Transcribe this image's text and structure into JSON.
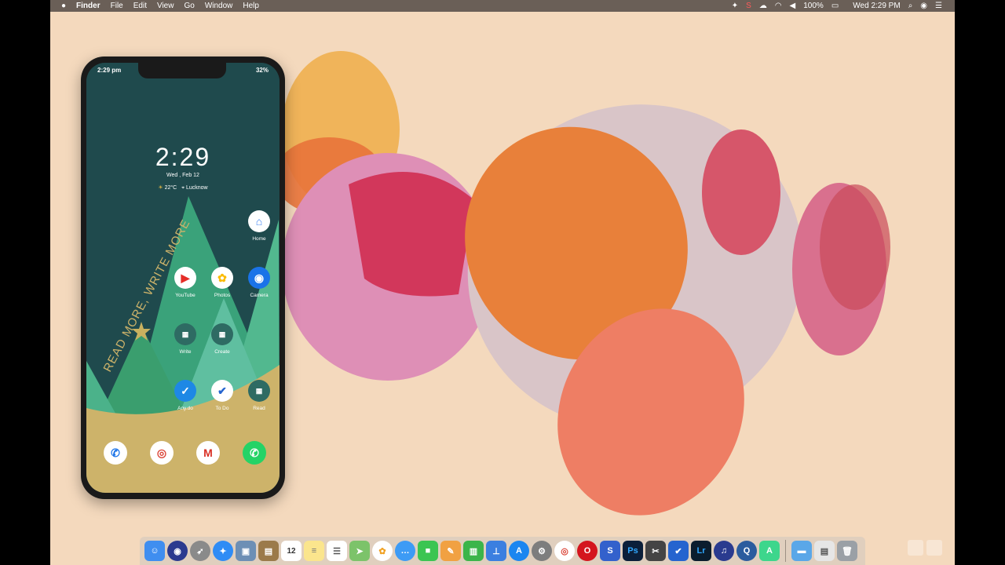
{
  "menubar": {
    "apple": "",
    "app": "Finder",
    "items": [
      "File",
      "Edit",
      "View",
      "Go",
      "Window",
      "Help"
    ],
    "battery": "100%",
    "datetime": "Wed 2:29 PM"
  },
  "phone": {
    "status_time": "2:29 pm",
    "status_battery": "32%",
    "clock": "2:29",
    "date": "Wed , Feb 12",
    "temperature": "22°C",
    "location": "Lucknow",
    "wallpaper_text": "READ MORE, WRITE MORE",
    "apps": {
      "home": "Home",
      "youtube": "YouTube",
      "photos": "Photos",
      "camera": "Camera",
      "write": "Write",
      "create": "Create",
      "anydo": "Any.do",
      "todo": "To Do",
      "read": "Read"
    }
  },
  "dock": {
    "icons": [
      "finder-icon",
      "siri-icon",
      "launchpad-icon",
      "safari-icon",
      "preview-icon",
      "notes-book-icon",
      "calendar-icon",
      "notes-icon",
      "reminders-icon",
      "maps-icon",
      "photos-icon",
      "messages-icon",
      "facetime-icon",
      "pages-icon",
      "numbers-icon",
      "keynote-icon",
      "app-store-icon",
      "system-preferences-icon",
      "chrome-icon",
      "opera-icon",
      "simplenote-icon",
      "photoshop-icon",
      "final-cut-icon",
      "todo-icon",
      "lightroom-icon",
      "audiobook-icon",
      "quicktime-icon",
      "android-studio-icon",
      "folder-icon",
      "downloads-icon",
      "trash-icon"
    ],
    "calendar_day": "12",
    "ps_label": "Ps",
    "lr_label": "Lr"
  },
  "colors": {
    "desktop": "#f4d9bd",
    "menubar": "#6a5f57",
    "phone_bg": "#1f4a4d",
    "phone_ground": "#cdb36a"
  }
}
